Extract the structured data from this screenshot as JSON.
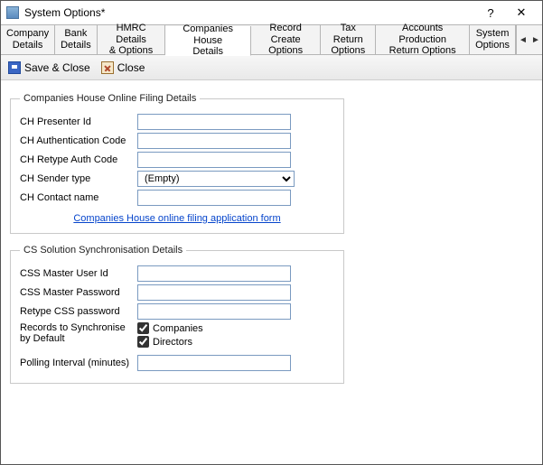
{
  "window": {
    "title": "System Options*",
    "help_glyph": "?",
    "close_glyph": "✕"
  },
  "tabs": [
    "Company\nDetails",
    "Bank\nDetails",
    "HMRC Details\n& Options",
    "Companies House\nDetails",
    "Record Create\nOptions",
    "Tax Return\nOptions",
    "Accounts Production\nReturn Options",
    "System\nOptions"
  ],
  "active_tab_index": 3,
  "nav": {
    "left": "◄",
    "right": "►"
  },
  "toolbar": {
    "save_close": "Save & Close",
    "close": "Close"
  },
  "group1": {
    "legend": "Companies House Online Filing Details",
    "presenter_label": "CH Presenter Id",
    "presenter_value": "",
    "auth_label": "CH Authentication Code",
    "auth_value": "",
    "retype_label": "CH Retype Auth Code",
    "retype_value": "",
    "sender_label": "CH Sender type",
    "sender_value": "(Empty)",
    "contact_label": "CH Contact name",
    "contact_value": "",
    "link_text": "Companies House online filing application form"
  },
  "group2": {
    "legend": "CS Solution Synchronisation Details",
    "user_label": "CSS Master User Id",
    "user_value": "",
    "pass_label": "CSS Master Password",
    "pass_value": "",
    "retype_label": "Retype CSS password",
    "retype_value": "",
    "records_label": "Records to Synchronise by Default",
    "chk_companies_label": "Companies",
    "chk_companies_checked": true,
    "chk_directors_label": "Directors",
    "chk_directors_checked": true,
    "poll_label": "Polling Interval (minutes)",
    "poll_value": ""
  }
}
